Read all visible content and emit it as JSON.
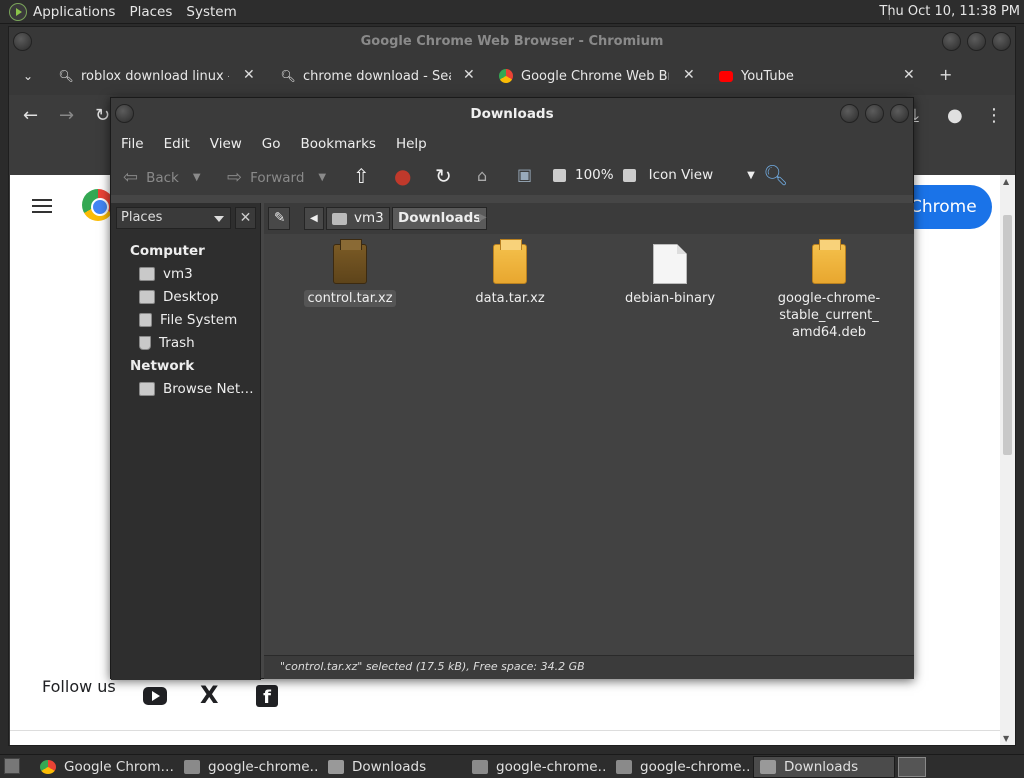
{
  "top_panel": {
    "menus": [
      "Applications",
      "Places",
      "System"
    ],
    "clock": "Thu Oct 10, 11:38 PM"
  },
  "chrome": {
    "window_title": "Google Chrome Web Browser - Chromium",
    "tabs": [
      {
        "title": "roblox download linux - S",
        "icon": "search-icon"
      },
      {
        "title": "chrome download - Searc",
        "icon": "search-icon"
      },
      {
        "title": "Google Chrome Web Bro",
        "icon": "chrome-icon"
      },
      {
        "title": "YouTube",
        "icon": "youtube-icon"
      }
    ],
    "page": {
      "download_button": "Chrome",
      "follow_us": "Follow us",
      "social_x": "X",
      "social_facebook": "f"
    }
  },
  "file_manager": {
    "title": "Downloads",
    "menus": [
      "File",
      "Edit",
      "View",
      "Go",
      "Bookmarks",
      "Help"
    ],
    "toolbar": {
      "back": "Back",
      "forward": "Forward",
      "zoom": "100%",
      "view_mode": "Icon View"
    },
    "sidebar": {
      "combo": "Places",
      "close": "✕",
      "computer_header": "Computer",
      "computer_items": [
        "vm3",
        "Desktop",
        "File System",
        "Trash"
      ],
      "network_header": "Network",
      "network_items": [
        "Browse Net…"
      ]
    },
    "path": [
      "vm3",
      "Downloads"
    ],
    "files": [
      {
        "name": "control.tar.xz",
        "type": "package",
        "selected": true
      },
      {
        "name": "data.tar.xz",
        "type": "package",
        "selected": false
      },
      {
        "name": "debian-binary",
        "type": "document",
        "selected": false
      },
      {
        "name": "google-chrome-stable_current_amd64.deb",
        "type": "package",
        "selected": false
      }
    ],
    "file_name_lines": {
      "deb_line1": "google-chrome-",
      "deb_line2": "stable_current_",
      "deb_line3": "amd64.deb"
    },
    "status": "\"control.tar.xz\" selected (17.5 kB), Free space: 34.2 GB"
  },
  "taskbar": {
    "tasks": [
      {
        "label": "Google Chrom…",
        "icon": "chrome-icon"
      },
      {
        "label": "google-chrome…",
        "icon": "package-icon"
      },
      {
        "label": "Downloads",
        "icon": "folder-icon"
      },
      {
        "label": "google-chrome…",
        "icon": "package-icon"
      },
      {
        "label": "google-chrome…",
        "icon": "package-icon"
      },
      {
        "label": "Downloads",
        "icon": "folder-icon"
      }
    ]
  }
}
